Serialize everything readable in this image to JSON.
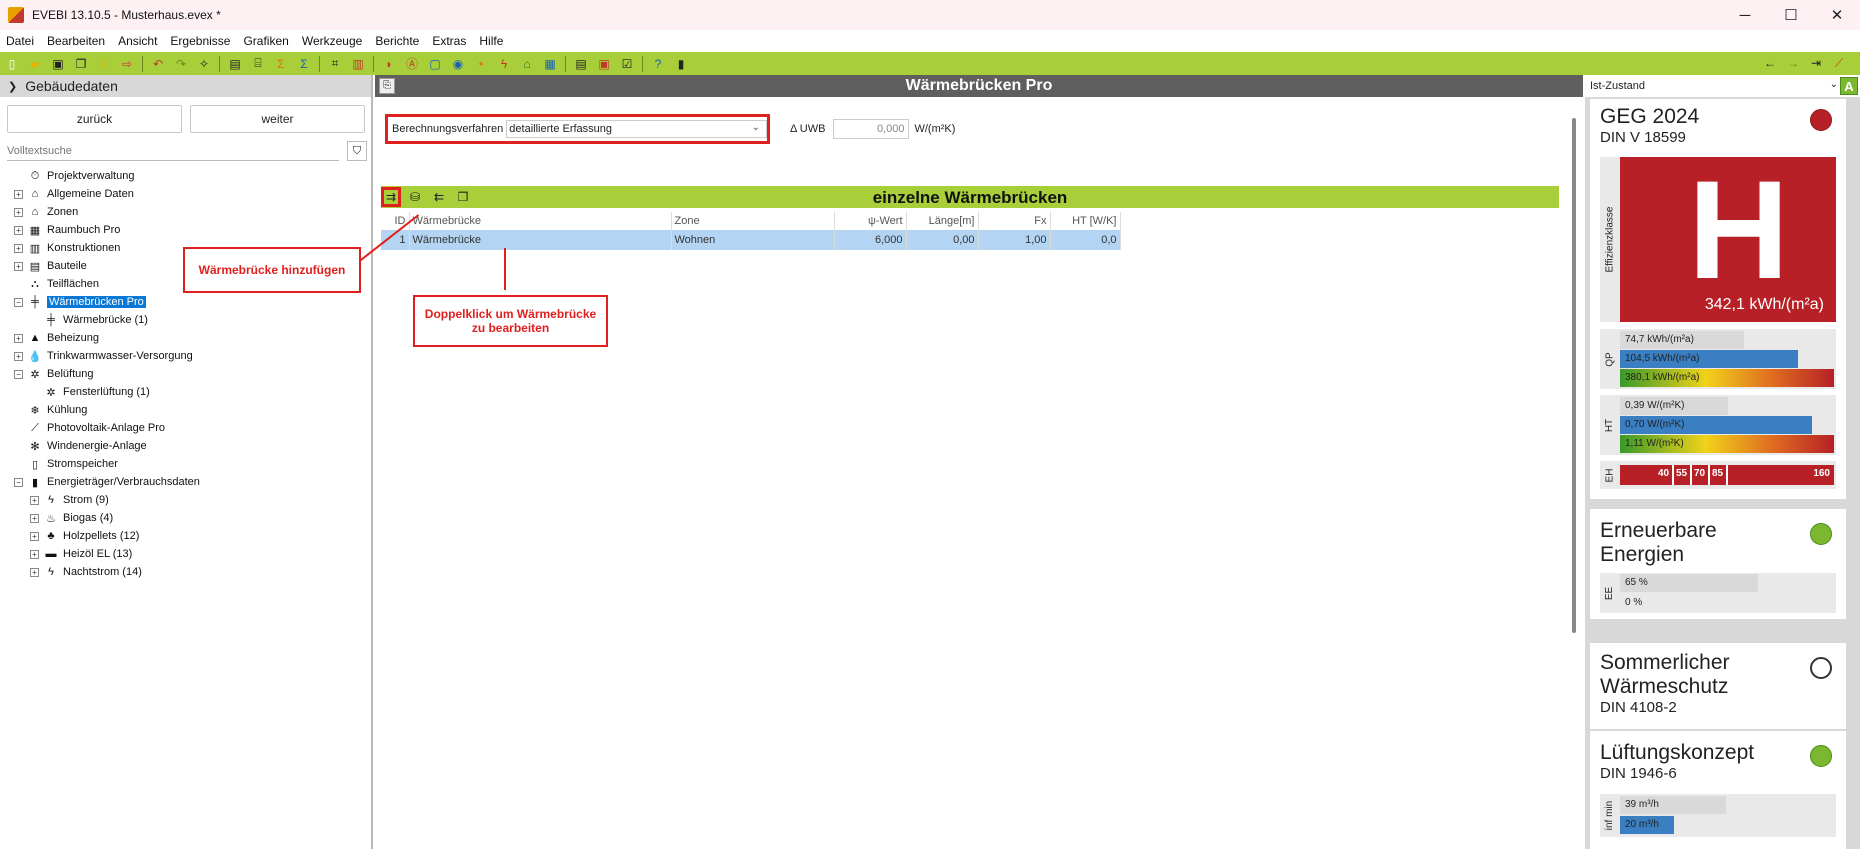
{
  "window": {
    "title": "EVEBI 13.10.5 - Musterhaus.evex *",
    "minimize": "─",
    "maximize": "☐",
    "close": "✕"
  },
  "menu": [
    "Datei",
    "Bearbeiten",
    "Ansicht",
    "Ergebnisse",
    "Grafiken",
    "Werkzeuge",
    "Berichte",
    "Extras",
    "Hilfe"
  ],
  "left": {
    "header": "Gebäudedaten",
    "back_label": "zurück",
    "next_label": "weiter",
    "search_placeholder": "Volltextsuche",
    "tree": [
      {
        "label": "Projektverwaltung",
        "level": 0,
        "expander": "",
        "icon": "⏱"
      },
      {
        "label": "Allgemeine Daten",
        "level": 0,
        "expander": "+",
        "icon": "⌂"
      },
      {
        "label": "Zonen",
        "level": 0,
        "expander": "+",
        "icon": "⌂"
      },
      {
        "label": "Raumbuch Pro",
        "level": 0,
        "expander": "+",
        "icon": "▦"
      },
      {
        "label": "Konstruktionen",
        "level": 0,
        "expander": "+",
        "icon": "▥"
      },
      {
        "label": "Bauteile",
        "level": 0,
        "expander": "+",
        "icon": "▤"
      },
      {
        "label": "Teilflächen",
        "level": 0,
        "expander": "",
        "icon": "⛬"
      },
      {
        "label": "Wärmebrücken Pro",
        "level": 0,
        "expander": "−",
        "icon": "╪",
        "selected": true
      },
      {
        "label": "Wärmebrücke (1)",
        "level": 1,
        "expander": "",
        "icon": "╪"
      },
      {
        "label": "Beheizung",
        "level": 0,
        "expander": "+",
        "icon": "▲"
      },
      {
        "label": "Trinkwarmwasser-Versorgung",
        "level": 0,
        "expander": "+",
        "icon": "💧"
      },
      {
        "label": "Belüftung",
        "level": 0,
        "expander": "−",
        "icon": "✲"
      },
      {
        "label": "Fensterlüftung (1)",
        "level": 1,
        "expander": "",
        "icon": "✲"
      },
      {
        "label": "Kühlung",
        "level": 0,
        "expander": "",
        "icon": "❄"
      },
      {
        "label": "Photovoltaik-Anlage Pro",
        "level": 0,
        "expander": "",
        "icon": "⟋"
      },
      {
        "label": "Windenergie-Anlage",
        "level": 0,
        "expander": "",
        "icon": "✻"
      },
      {
        "label": "Stromspeicher",
        "level": 0,
        "expander": "",
        "icon": "▯"
      },
      {
        "label": "Energieträger/Verbrauchsdaten",
        "level": 0,
        "expander": "−",
        "icon": "▮"
      },
      {
        "label": "Strom (9)",
        "level": 1,
        "expander": "+",
        "icon": "ϟ"
      },
      {
        "label": "Biogas (4)",
        "level": 1,
        "expander": "+",
        "icon": "♨"
      },
      {
        "label": "Holzpellets (12)",
        "level": 1,
        "expander": "+",
        "icon": "♣"
      },
      {
        "label": "Heizöl EL (13)",
        "level": 1,
        "expander": "+",
        "icon": "▬"
      },
      {
        "label": "Nachtstrom (14)",
        "level": 1,
        "expander": "+",
        "icon": "ϟ"
      }
    ]
  },
  "center": {
    "header": "Wärmebrücken Pro",
    "method_label": "Berechnungsverfahren",
    "method_value": "detaillierte Erfassung",
    "uwb_label": "Δ UWB",
    "uwb_value": "0,000",
    "uwb_unit": "W/(m²K)",
    "panel_title": "einzelne Wärmebrücken",
    "table": {
      "columns": [
        "ID",
        "Wärmebrücke",
        "Zone",
        "ψ-Wert",
        "Länge[m]",
        "Fx",
        "HT [W/K]"
      ],
      "rows": [
        [
          "1",
          "Wärmebrücke",
          "Wohnen",
          "6,000",
          "0,00",
          "1,00",
          "0,0"
        ]
      ]
    },
    "annotation_add": "Wärmebrücke hinzufügen",
    "annotation_edit_line1": "Doppelklick um Wärmebrücke",
    "annotation_edit_line2": "zu bearbeiten"
  },
  "right": {
    "state": "Ist-Zustand",
    "a_button": "A",
    "geg": {
      "title": "GEG 2024",
      "subtitle": "DIN V 18599",
      "status_color": "#b72026",
      "class_label": "Effizienzklasse",
      "class_letter": "H",
      "class_value": "342,1 kWh/(m²a)",
      "qp_label": "QP",
      "qp_bars": [
        "74,7 kWh/(m²a)",
        "104,5 kWh/(m²a)",
        "380,1 kWh/(m²a)"
      ],
      "ht_label": "HT",
      "ht_bars": [
        "0,39 W/(m²K)",
        "0,70 W/(m²K)",
        "1,11 W/(m²K)"
      ],
      "eh_label": "EH",
      "eh_ticks": [
        "40",
        "55",
        "70",
        "85",
        "160"
      ]
    },
    "ee": {
      "title_line1": "Erneuerbare",
      "title_line2": "Energien",
      "status_color": "#7cb82f",
      "label": "EE",
      "bars": [
        "65 %",
        "0 %"
      ]
    },
    "sw": {
      "title_line1": "Sommerlicher",
      "title_line2": "Wärmeschutz",
      "subtitle": "DIN 4108-2",
      "status_color": "#ffffff"
    },
    "lk": {
      "title": "Lüftungskonzept",
      "subtitle": "DIN 1946-6",
      "status_color": "#7cb82f",
      "label": "inf min",
      "bars": [
        "39 m³/h",
        "20 m³/h"
      ]
    }
  }
}
